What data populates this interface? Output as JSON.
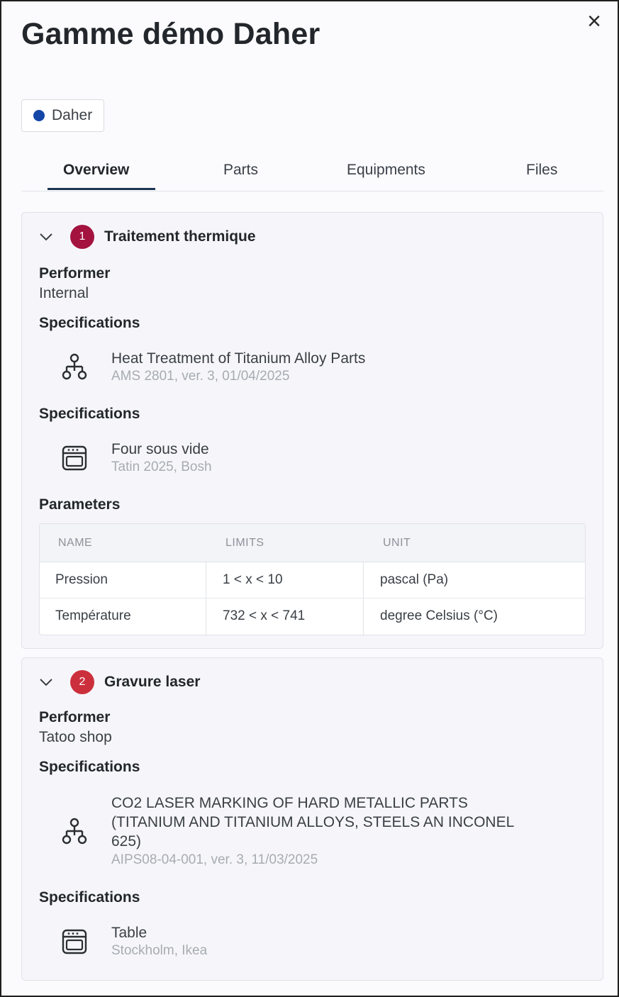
{
  "header": {
    "title": "Gamme démo Daher",
    "close_symbol": "×"
  },
  "chip": {
    "label": "Daher",
    "dot_color": "#1446a8"
  },
  "tabs": [
    {
      "label": "Overview",
      "active": true
    },
    {
      "label": "Parts",
      "active": false
    },
    {
      "label": "Equipments",
      "active": false
    },
    {
      "label": "Files",
      "active": false
    }
  ],
  "steps": [
    {
      "number": "1",
      "title": "Traitement thermique",
      "badge_color": "#a4123f",
      "performer_label": "Performer",
      "performer": "Internal",
      "specifications": [
        {
          "label": "Specifications",
          "icon": "hierarchy-icon",
          "main": "Heat Treatment of Titanium Alloy Parts",
          "sub": "AMS 2801, ver. 3, 01/04/2025"
        },
        {
          "label": "Specifications",
          "icon": "oven-icon",
          "main": "Four sous vide",
          "sub": "Tatin 2025, Bosh"
        }
      ],
      "parameters": {
        "label": "Parameters",
        "columns": [
          "NAME",
          "LIMITS",
          "UNIT"
        ],
        "rows": [
          [
            "Pression",
            "1 < x < 10",
            "pascal (Pa)"
          ],
          [
            "Température",
            "732 < x < 741",
            "degree Celsius (°C)"
          ]
        ]
      }
    },
    {
      "number": "2",
      "title": "Gravure laser",
      "badge_color": "#cc2f3c",
      "performer_label": "Performer",
      "performer": "Tatoo shop",
      "specifications": [
        {
          "label": "Specifications",
          "icon": "hierarchy-icon",
          "main_lines": [
            "CO2 LASER MARKING OF HARD METALLIC PARTS",
            "(TITANIUM AND TITANIUM ALLOYS, STEELS AN INCONEL",
            "625)"
          ],
          "sub": "AIPS08-04-001, ver. 3, 11/03/2025"
        },
        {
          "label": "Specifications",
          "icon": "oven-icon",
          "main": "Table",
          "sub": "Stockholm, Ikea"
        }
      ]
    }
  ]
}
